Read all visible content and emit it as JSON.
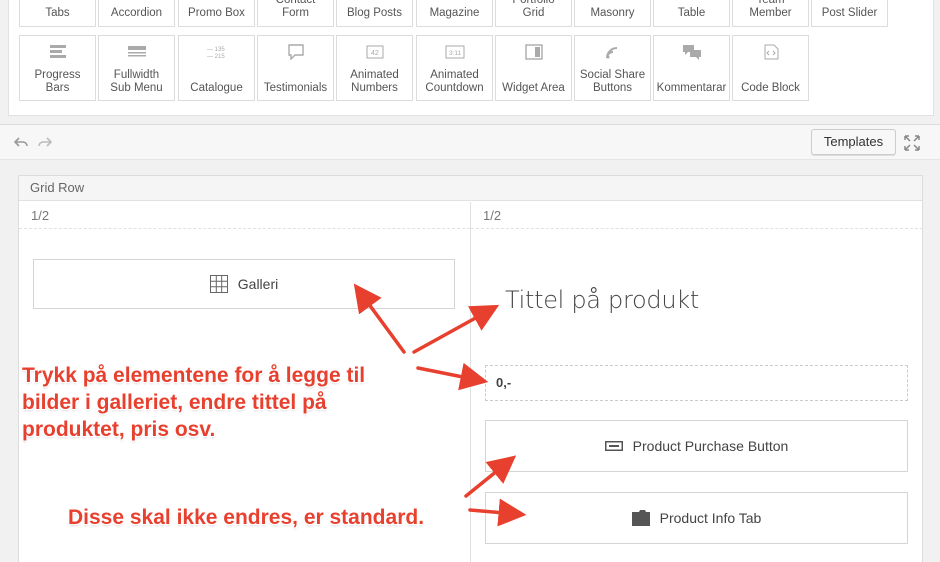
{
  "picker": {
    "row1": [
      {
        "label": "Tabs",
        "icon": "tabs-icon"
      },
      {
        "label": "Accordion",
        "icon": "accordion-icon"
      },
      {
        "label": "Promo Box",
        "icon": "promo-box-icon"
      },
      {
        "label": "Contact\nForm",
        "icon": "contact-form-icon"
      },
      {
        "label": "Blog Posts",
        "icon": "blog-posts-icon"
      },
      {
        "label": "Magazine",
        "icon": "magazine-icon"
      },
      {
        "label": "Portfolio\nGrid",
        "icon": "portfolio-grid-icon"
      },
      {
        "label": "Masonry",
        "icon": "masonry-icon"
      },
      {
        "label": "Table",
        "icon": "table-icon"
      },
      {
        "label": "Team\nMember",
        "icon": "team-member-icon"
      },
      {
        "label": "Post Slider",
        "icon": "post-slider-icon"
      }
    ],
    "row2": [
      {
        "label": "Progress\nBars",
        "icon": "progress-bars-icon"
      },
      {
        "label": "Fullwidth\nSub Menu",
        "icon": "fullwidth-submenu-icon"
      },
      {
        "label": "Catalogue",
        "icon": "catalogue-icon",
        "sample": [
          "135",
          "215"
        ]
      },
      {
        "label": "Testimonials",
        "icon": "testimonials-icon"
      },
      {
        "label": "Animated\nNumbers",
        "icon": "animated-numbers-icon",
        "sample": "42"
      },
      {
        "label": "Animated\nCountdown",
        "icon": "animated-countdown-icon",
        "sample": "3:11"
      },
      {
        "label": "Widget Area",
        "icon": "widget-area-icon"
      },
      {
        "label": "Social Share\nButtons",
        "icon": "social-share-icon"
      },
      {
        "label": "Kommentarar",
        "icon": "comments-icon"
      },
      {
        "label": "Code Block",
        "icon": "code-block-icon"
      }
    ]
  },
  "toolbar": {
    "templates_label": "Templates"
  },
  "grid_row": {
    "title": "Grid Row",
    "col_a": {
      "size": "1/2",
      "galleri_label": "Galleri"
    },
    "col_b": {
      "size": "1/2",
      "product_title": "Tittel på produkt",
      "price": "0,-",
      "purchase_label": "Product Purchase Button",
      "info_tab_label": "Product Info Tab"
    }
  },
  "annotations": {
    "main": "Trykk på elementene for å legge til bilder i galleriet, endre tittel på produktet, pris osv.",
    "standard": "Disse skal ikke endres, er standard."
  },
  "colors": {
    "annotation": "#e8402e",
    "border": "#dcdcdc"
  }
}
